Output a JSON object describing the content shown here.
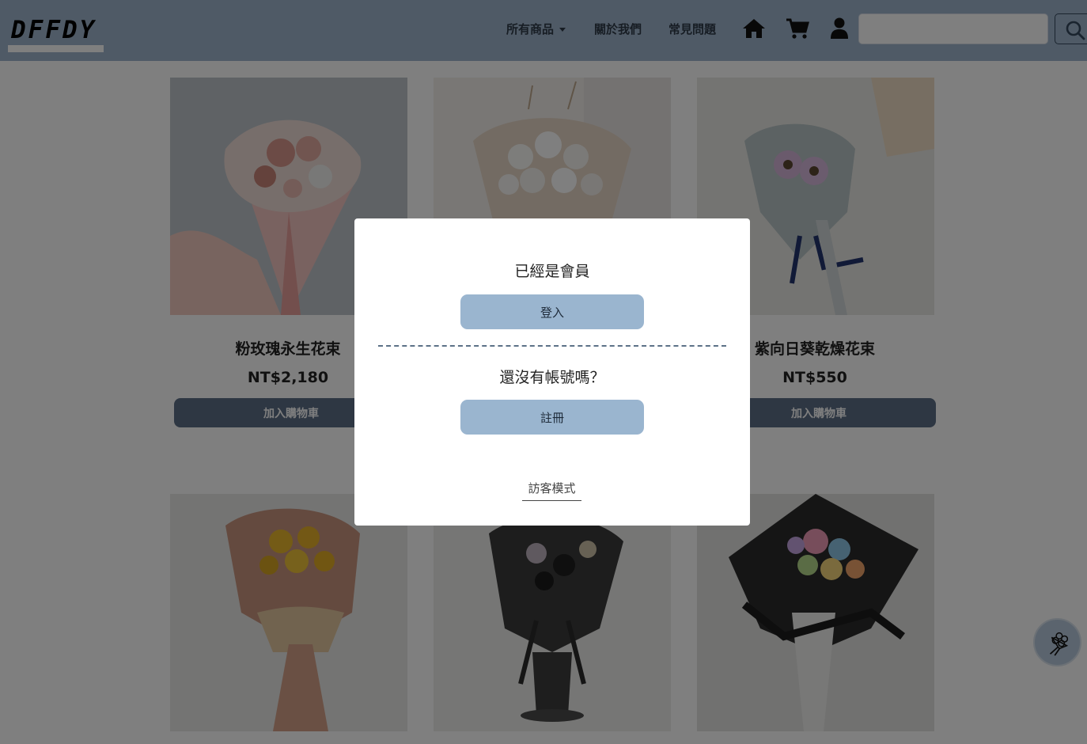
{
  "brand": {
    "logo_text": "DFFDY"
  },
  "nav": {
    "all_products": "所有商品",
    "about_us": "關於我們",
    "faq": "常見問題",
    "icons": [
      "home-icon",
      "cart-icon",
      "user-icon",
      "search-icon"
    ]
  },
  "search": {
    "value": "",
    "placeholder": ""
  },
  "products": [
    {
      "name": "粉玫瑰永生花束",
      "price": "NT$2,180",
      "cart_label": "加入購物車"
    },
    {
      "name": "",
      "price": "",
      "cart_label": ""
    },
    {
      "name": "紫向日葵乾燥花束",
      "price": "NT$550",
      "cart_label": "加入購物車"
    },
    {
      "name": "",
      "price": "",
      "cart_label": ""
    },
    {
      "name": "",
      "price": "",
      "cart_label": ""
    },
    {
      "name": "",
      "price": "",
      "cart_label": ""
    }
  ],
  "modal": {
    "member_heading": "已經是會員",
    "login_label": "登入",
    "no_account_heading": "還沒有帳號嗎？",
    "register_label": "註冊",
    "guest_label": "訪客模式"
  },
  "colors": {
    "navbar": "#9fb4cc",
    "button_dark": "#5c6f86",
    "modal_button": "#9ab5cf",
    "overlay": "rgba(0,0,0,0.5)"
  },
  "floating_button": {
    "icon": "bouquet-icon"
  }
}
